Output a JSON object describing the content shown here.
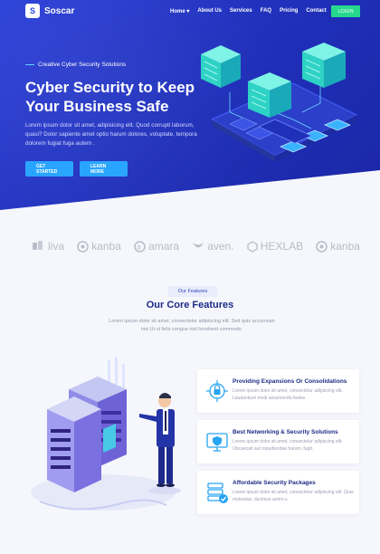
{
  "brand": {
    "name": "Soscar",
    "logo_letter": "S"
  },
  "nav": {
    "items": [
      "Home ▾",
      "About Us",
      "Services",
      "FAQ",
      "Pricing",
      "Contact"
    ],
    "login_label": "LOGIN"
  },
  "hero": {
    "subtitle": "Creative Cyber Security Solutions",
    "title": "Cyber Security to Keep Your Business Safe",
    "text": "Lorem ipsum dolor sit amet, adipisicing elit. Quod corrupti laborum, quasi? Dolor sapiente amet optio harum dolores, voluptate, tempora dolorem fugiat fuga autem .",
    "btn_start": "GET STARTED",
    "btn_more": "LEARN MORE"
  },
  "brands": [
    "liva",
    "kanba",
    "amara",
    "aven.",
    "HEXLAB",
    "kanba"
  ],
  "features": {
    "badge": "Our Features",
    "title": "Our Core Features",
    "text": "Lorem ipsum dolor sit amet, consectetur adipiscing elit. Sed quis accumsan nisi Ut ut felis congue nisl hendrerit commodo.",
    "cards": [
      {
        "title": "Providing Expansions Or Consolidations",
        "text": "Lorem ipsum dolor sit amet, consectetur adipiscing elit. Laudantium modi assumenda fealse."
      },
      {
        "title": "Best Networking & Security Solutions",
        "text": "Lorem ipsum dolor sit amet, consectetur adipiscing elit. Obcaecati aut repudiandae harum, fugit."
      },
      {
        "title": "Affordable Security Packages",
        "text": "Lorem ipsum dolor sit amet, consectetur adipiscing elit. Quia molestias, ducimus animi o."
      }
    ]
  },
  "colors": {
    "primary": "#2a3fd8",
    "accent": "#26d98d",
    "cyan": "#2aa5ff",
    "heading": "#1c2a86"
  }
}
